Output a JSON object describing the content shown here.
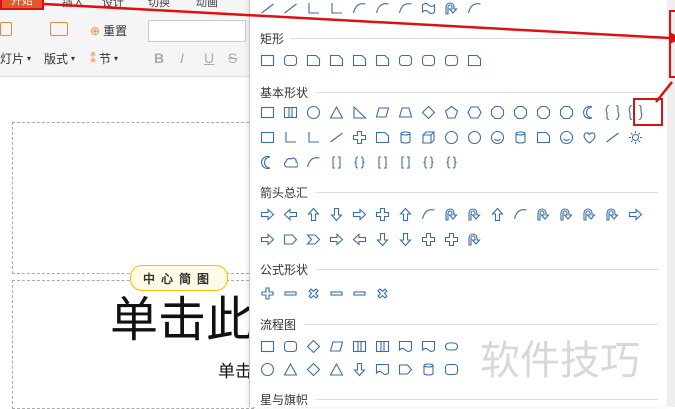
{
  "ribbon": {
    "home_tab": "开始",
    "menu_items": [
      "插入",
      "设计",
      "切换",
      "动画"
    ],
    "new_slide_label": "灯片",
    "layout_label": "版式",
    "reset_label": "重置",
    "section_label": "节",
    "format_buttons": [
      "B",
      "I",
      "U",
      "S"
    ]
  },
  "panel": {
    "sections": [
      {
        "title": "矩形"
      },
      {
        "title": "基本形状"
      },
      {
        "title": "箭头总汇"
      },
      {
        "title": "公式形状"
      },
      {
        "title": "流程图"
      },
      {
        "title": "星与旗帜"
      }
    ]
  },
  "slide": {
    "badge_text": "中心简图",
    "title_text": "单击此",
    "subtitle_text": "单击"
  },
  "watermark": "软件技巧",
  "colors": {
    "accent": "#e4572e",
    "shape_stroke": "#3b6ea5",
    "highlight": "#dd1111"
  }
}
